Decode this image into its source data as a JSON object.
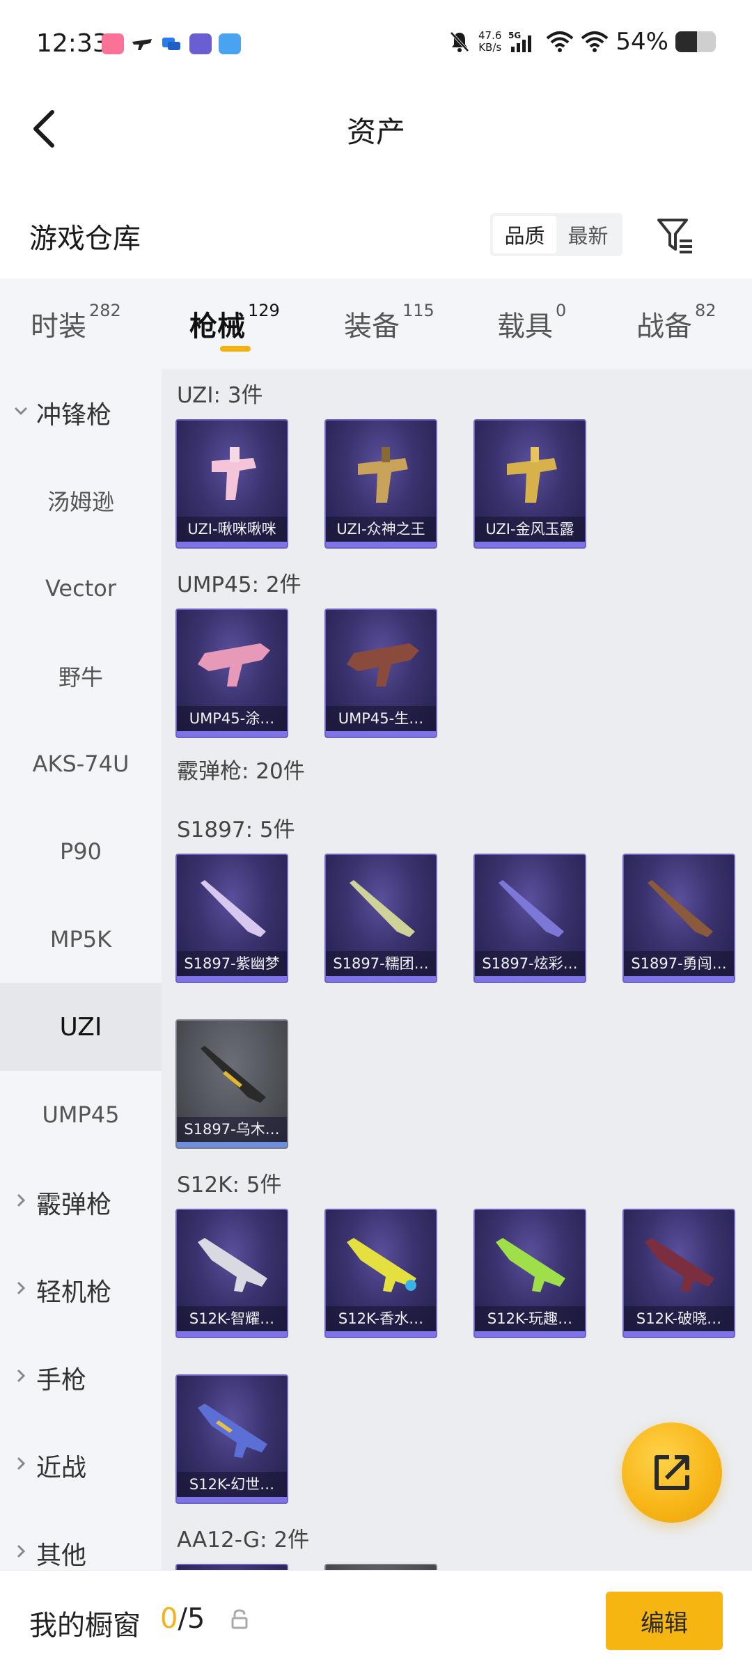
{
  "status_bar": {
    "time": "12:33",
    "net_speed_value": "47.6",
    "net_speed_unit": "KB/s",
    "network": "5G",
    "battery_pct": "54%",
    "battery_level": 0.54,
    "app_icons": [
      "bilibili-icon",
      "drone-icon",
      "chat-icon",
      "game-mascot-icon",
      "photos-icon"
    ]
  },
  "title_bar": {
    "title": "资产"
  },
  "warehouse": {
    "title": "游戏仓库",
    "sort_options": [
      "品质",
      "最新"
    ],
    "active_sort": "品质"
  },
  "tabs": [
    {
      "label": "时装",
      "count": "282"
    },
    {
      "label": "枪械",
      "count": "129",
      "active": true
    },
    {
      "label": "装备",
      "count": "115"
    },
    {
      "label": "载具",
      "count": "0"
    },
    {
      "label": "战备",
      "count": "82"
    }
  ],
  "sidebar": [
    {
      "label": "冲锋枪",
      "type": "group",
      "expanded": true
    },
    {
      "label": "汤姆逊"
    },
    {
      "label": "Vector"
    },
    {
      "label": "野牛"
    },
    {
      "label": "AKS-74U"
    },
    {
      "label": "P90"
    },
    {
      "label": "MP5K"
    },
    {
      "label": "UZI",
      "selected": true
    },
    {
      "label": "UMP45"
    },
    {
      "label": "霰弹枪",
      "type": "group"
    },
    {
      "label": "轻机枪",
      "type": "group"
    },
    {
      "label": "手枪",
      "type": "group"
    },
    {
      "label": "近战",
      "type": "group"
    },
    {
      "label": "其他",
      "type": "group"
    }
  ],
  "sections": {
    "uzi": "UZI: 3件",
    "ump45": "UMP45: 2件",
    "shotgun": "霰弹枪: 20件",
    "s1897": "S1897: 5件",
    "s12k": "S12K: 5件",
    "aa12g": "AA12-G: 2件"
  },
  "items": {
    "uzi": [
      "UZI-啾咪啾咪",
      "UZI-众神之王",
      "UZI-金风玉露"
    ],
    "ump45": [
      "UMP45-涂…",
      "UMP45-生…"
    ],
    "s1897": [
      "S1897-紫幽梦",
      "S1897-糯团…",
      "S1897-炫彩…",
      "S1897-勇闯…",
      "S1897-乌木…"
    ],
    "s12k": [
      "S12K-智耀…",
      "S12K-香水…",
      "S12K-玩趣…",
      "S12K-破晓…",
      "S12K-幻世…"
    ]
  },
  "bottom_bar": {
    "label": "我的橱窗",
    "current": "0",
    "total": "/5",
    "edit_label": "编辑"
  },
  "colors": {
    "accent": "#f6b511",
    "card_bg": "#3a326e",
    "card_border": "#6f64c2"
  }
}
